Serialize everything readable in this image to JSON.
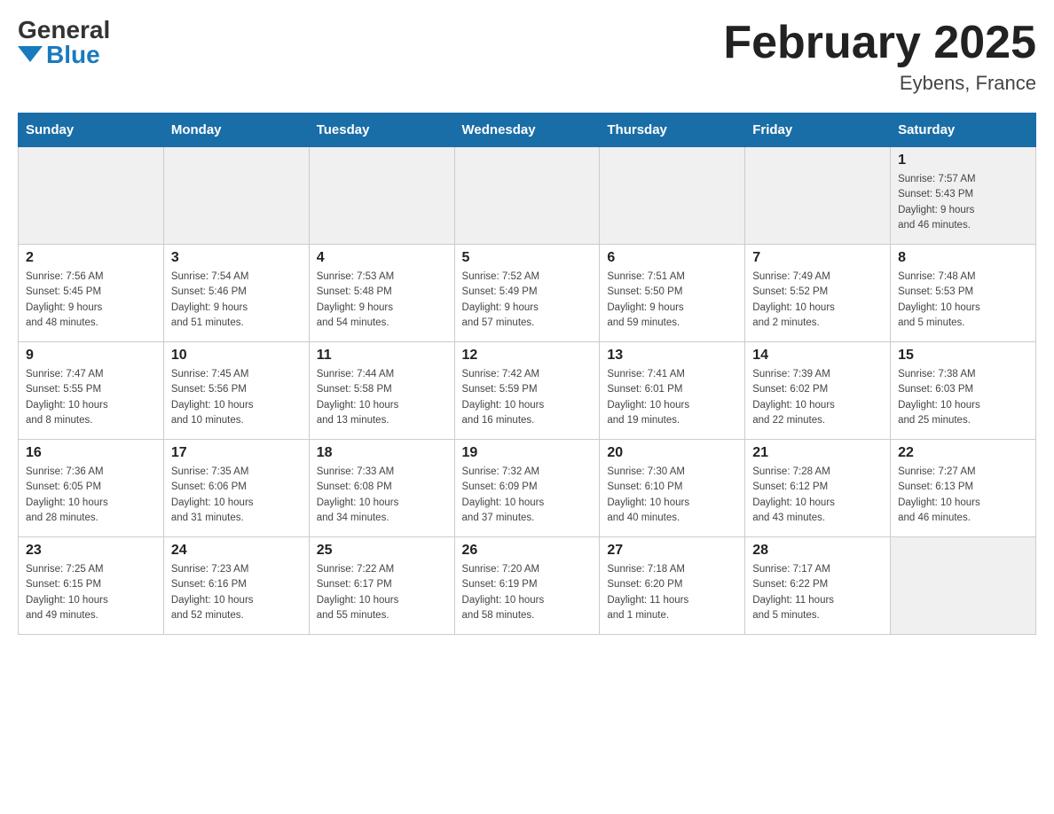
{
  "header": {
    "logo_general": "General",
    "logo_blue": "Blue",
    "title": "February 2025",
    "subtitle": "Eybens, France"
  },
  "days_of_week": [
    "Sunday",
    "Monday",
    "Tuesday",
    "Wednesday",
    "Thursday",
    "Friday",
    "Saturday"
  ],
  "weeks": [
    [
      {
        "day": "",
        "info": ""
      },
      {
        "day": "",
        "info": ""
      },
      {
        "day": "",
        "info": ""
      },
      {
        "day": "",
        "info": ""
      },
      {
        "day": "",
        "info": ""
      },
      {
        "day": "",
        "info": ""
      },
      {
        "day": "1",
        "info": "Sunrise: 7:57 AM\nSunset: 5:43 PM\nDaylight: 9 hours\nand 46 minutes."
      }
    ],
    [
      {
        "day": "2",
        "info": "Sunrise: 7:56 AM\nSunset: 5:45 PM\nDaylight: 9 hours\nand 48 minutes."
      },
      {
        "day": "3",
        "info": "Sunrise: 7:54 AM\nSunset: 5:46 PM\nDaylight: 9 hours\nand 51 minutes."
      },
      {
        "day": "4",
        "info": "Sunrise: 7:53 AM\nSunset: 5:48 PM\nDaylight: 9 hours\nand 54 minutes."
      },
      {
        "day": "5",
        "info": "Sunrise: 7:52 AM\nSunset: 5:49 PM\nDaylight: 9 hours\nand 57 minutes."
      },
      {
        "day": "6",
        "info": "Sunrise: 7:51 AM\nSunset: 5:50 PM\nDaylight: 9 hours\nand 59 minutes."
      },
      {
        "day": "7",
        "info": "Sunrise: 7:49 AM\nSunset: 5:52 PM\nDaylight: 10 hours\nand 2 minutes."
      },
      {
        "day": "8",
        "info": "Sunrise: 7:48 AM\nSunset: 5:53 PM\nDaylight: 10 hours\nand 5 minutes."
      }
    ],
    [
      {
        "day": "9",
        "info": "Sunrise: 7:47 AM\nSunset: 5:55 PM\nDaylight: 10 hours\nand 8 minutes."
      },
      {
        "day": "10",
        "info": "Sunrise: 7:45 AM\nSunset: 5:56 PM\nDaylight: 10 hours\nand 10 minutes."
      },
      {
        "day": "11",
        "info": "Sunrise: 7:44 AM\nSunset: 5:58 PM\nDaylight: 10 hours\nand 13 minutes."
      },
      {
        "day": "12",
        "info": "Sunrise: 7:42 AM\nSunset: 5:59 PM\nDaylight: 10 hours\nand 16 minutes."
      },
      {
        "day": "13",
        "info": "Sunrise: 7:41 AM\nSunset: 6:01 PM\nDaylight: 10 hours\nand 19 minutes."
      },
      {
        "day": "14",
        "info": "Sunrise: 7:39 AM\nSunset: 6:02 PM\nDaylight: 10 hours\nand 22 minutes."
      },
      {
        "day": "15",
        "info": "Sunrise: 7:38 AM\nSunset: 6:03 PM\nDaylight: 10 hours\nand 25 minutes."
      }
    ],
    [
      {
        "day": "16",
        "info": "Sunrise: 7:36 AM\nSunset: 6:05 PM\nDaylight: 10 hours\nand 28 minutes."
      },
      {
        "day": "17",
        "info": "Sunrise: 7:35 AM\nSunset: 6:06 PM\nDaylight: 10 hours\nand 31 minutes."
      },
      {
        "day": "18",
        "info": "Sunrise: 7:33 AM\nSunset: 6:08 PM\nDaylight: 10 hours\nand 34 minutes."
      },
      {
        "day": "19",
        "info": "Sunrise: 7:32 AM\nSunset: 6:09 PM\nDaylight: 10 hours\nand 37 minutes."
      },
      {
        "day": "20",
        "info": "Sunrise: 7:30 AM\nSunset: 6:10 PM\nDaylight: 10 hours\nand 40 minutes."
      },
      {
        "day": "21",
        "info": "Sunrise: 7:28 AM\nSunset: 6:12 PM\nDaylight: 10 hours\nand 43 minutes."
      },
      {
        "day": "22",
        "info": "Sunrise: 7:27 AM\nSunset: 6:13 PM\nDaylight: 10 hours\nand 46 minutes."
      }
    ],
    [
      {
        "day": "23",
        "info": "Sunrise: 7:25 AM\nSunset: 6:15 PM\nDaylight: 10 hours\nand 49 minutes."
      },
      {
        "day": "24",
        "info": "Sunrise: 7:23 AM\nSunset: 6:16 PM\nDaylight: 10 hours\nand 52 minutes."
      },
      {
        "day": "25",
        "info": "Sunrise: 7:22 AM\nSunset: 6:17 PM\nDaylight: 10 hours\nand 55 minutes."
      },
      {
        "day": "26",
        "info": "Sunrise: 7:20 AM\nSunset: 6:19 PM\nDaylight: 10 hours\nand 58 minutes."
      },
      {
        "day": "27",
        "info": "Sunrise: 7:18 AM\nSunset: 6:20 PM\nDaylight: 11 hours\nand 1 minute."
      },
      {
        "day": "28",
        "info": "Sunrise: 7:17 AM\nSunset: 6:22 PM\nDaylight: 11 hours\nand 5 minutes."
      },
      {
        "day": "",
        "info": ""
      }
    ]
  ]
}
